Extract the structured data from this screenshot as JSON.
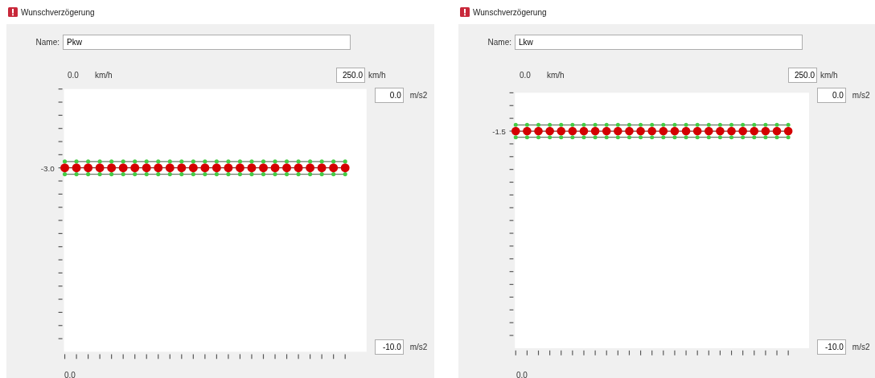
{
  "panels": [
    {
      "title": "Wunschverzögerung",
      "name_label": "Name:",
      "name_value": "Pkw",
      "speed_min": "0.0",
      "speed_min_unit": "km/h",
      "speed_max": "250.0",
      "speed_max_unit": "km/h",
      "accel_max": "0.0",
      "accel_max_unit": "m/s2",
      "accel_min": "-10.0",
      "accel_min_unit": "m/s2",
      "value_label": "-3.0",
      "x_label": "0.0"
    },
    {
      "title": "Wunschverzögerung",
      "name_label": "Name:",
      "name_value": "Lkw",
      "speed_min": "0.0",
      "speed_min_unit": "km/h",
      "speed_max": "250.0",
      "speed_max_unit": "km/h",
      "accel_max": "0.0",
      "accel_max_unit": "m/s2",
      "accel_min": "-10.0",
      "accel_min_unit": "m/s2",
      "value_label": "-1.5",
      "x_label": "0.0"
    }
  ]
}
